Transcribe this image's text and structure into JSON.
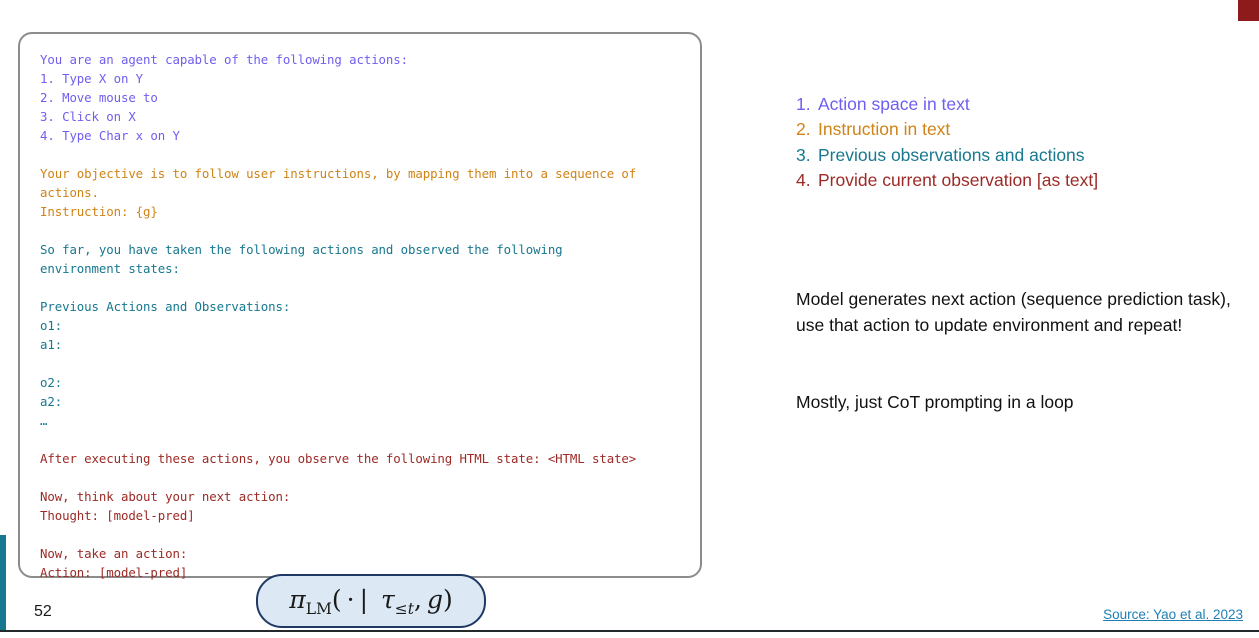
{
  "slide": {
    "page_number": "52",
    "source_link": "Source: Yao et al. 2023",
    "accent_red": "#8d1b1b",
    "accent_teal": "#17788f"
  },
  "colors": {
    "action_space": "#6f5ff0",
    "instruction": "#d08316",
    "history": "#17788f",
    "observation": "#9c2a26"
  },
  "prompt": {
    "lines": [
      {
        "text": "You are an agent capable of the following actions:",
        "color": "blue"
      },
      {
        "text": "1. Type X on Y",
        "color": "blue"
      },
      {
        "text": "2. Move mouse to",
        "color": "blue"
      },
      {
        "text": "3. Click on X",
        "color": "blue"
      },
      {
        "text": "4. Type Char x on Y",
        "color": "blue"
      },
      {
        "text": "",
        "color": "blue"
      },
      {
        "text": "Your objective is to follow user instructions, by mapping them into a sequence of",
        "color": "orange"
      },
      {
        "text": "actions.",
        "color": "orange"
      },
      {
        "text": "Instruction: {g}",
        "color": "orange"
      },
      {
        "text": "",
        "color": "orange"
      },
      {
        "text": "So far, you have taken the following actions and observed the following",
        "color": "teal"
      },
      {
        "text": "environment states:",
        "color": "teal"
      },
      {
        "text": "",
        "color": "teal"
      },
      {
        "text": "Previous Actions and Observations:",
        "color": "teal"
      },
      {
        "text": "o1:",
        "color": "teal"
      },
      {
        "text": "a1:",
        "color": "teal"
      },
      {
        "text": "",
        "color": "teal"
      },
      {
        "text": "o2:",
        "color": "teal"
      },
      {
        "text": "a2:",
        "color": "teal"
      },
      {
        "text": "…",
        "color": "teal"
      },
      {
        "text": "",
        "color": "teal"
      },
      {
        "text": "After executing these actions, you observe the following HTML state: <HTML state>",
        "color": "red"
      },
      {
        "text": "",
        "color": "red"
      },
      {
        "text": "Now, think about your next action:",
        "color": "red"
      },
      {
        "text": "Thought: [model-pred]",
        "color": "red"
      },
      {
        "text": "",
        "color": "red"
      },
      {
        "text": "Now, take an action:",
        "color": "red"
      },
      {
        "text": "Action: [model-pred]",
        "color": "red"
      }
    ]
  },
  "right_column": {
    "numbered_items": [
      {
        "num": "1.",
        "label": "Action space in text",
        "color": "blue"
      },
      {
        "num": "2.",
        "label": "Instruction in text",
        "color": "orange"
      },
      {
        "num": "3.",
        "label": "Previous observations and actions",
        "color": "teal"
      },
      {
        "num": "4.",
        "label": "Provide current observation [as text]",
        "color": "red"
      }
    ],
    "note_primary": "Model generates next action (sequence prediction task), use that action to update environment and repeat!",
    "note_secondary": "Mostly, just CoT prompting in a loop"
  },
  "formula": {
    "plain": "π_LM( · | τ_≤t , g )",
    "policy_symbol": "π",
    "policy_subscript": "LM",
    "argument": "·",
    "separator": "|",
    "trajectory_symbol": "τ",
    "trajectory_subscript": "≤t",
    "goal_symbol": "g",
    "fill_color": "#dce9f5",
    "border_color": "#1f3864"
  }
}
